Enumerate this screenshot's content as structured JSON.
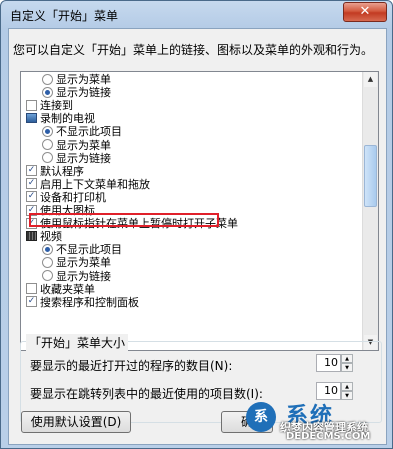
{
  "window": {
    "title": "自定义「开始」菜单",
    "close_glyph": "✕"
  },
  "description": "您可以自定义「开始」菜单上的链接、图标以及菜单的外观和行为。",
  "tree_items": [
    {
      "kind": "radio",
      "indent": 2,
      "checked": false,
      "label": "显示为菜单"
    },
    {
      "kind": "radio",
      "indent": 2,
      "checked": true,
      "label": "显示为链接"
    },
    {
      "kind": "checkbox",
      "indent": 1,
      "checked": false,
      "label": "连接到"
    },
    {
      "kind": "icon",
      "icon": "tv-icon",
      "indent": 1,
      "label": "录制的电视"
    },
    {
      "kind": "radio",
      "indent": 2,
      "checked": true,
      "label": "不显示此项目"
    },
    {
      "kind": "radio",
      "indent": 2,
      "checked": false,
      "label": "显示为菜单"
    },
    {
      "kind": "radio",
      "indent": 2,
      "checked": false,
      "label": "显示为链接"
    },
    {
      "kind": "checkbox",
      "indent": 1,
      "checked": true,
      "label": "默认程序"
    },
    {
      "kind": "checkbox",
      "indent": 1,
      "checked": true,
      "label": "启用上下文菜单和拖放",
      "highlighted": true
    },
    {
      "kind": "checkbox",
      "indent": 1,
      "checked": true,
      "label": "设备和打印机"
    },
    {
      "kind": "checkbox",
      "indent": 1,
      "checked": true,
      "label": "使用大图标"
    },
    {
      "kind": "checkbox",
      "indent": 1,
      "checked": true,
      "label": "使用鼠标指针在菜单上暂停时打开子菜单"
    },
    {
      "kind": "icon",
      "icon": "video-icon",
      "indent": 1,
      "label": "视频"
    },
    {
      "kind": "radio",
      "indent": 2,
      "checked": true,
      "label": "不显示此项目"
    },
    {
      "kind": "radio",
      "indent": 2,
      "checked": false,
      "label": "显示为菜单"
    },
    {
      "kind": "radio",
      "indent": 2,
      "checked": false,
      "label": "显示为链接"
    },
    {
      "kind": "checkbox",
      "indent": 1,
      "checked": false,
      "label": "收藏夹菜单"
    },
    {
      "kind": "checkbox",
      "indent": 1,
      "checked": true,
      "label": "搜索程序和控制面板"
    }
  ],
  "size_group": {
    "title": "「开始」菜单大小",
    "recent_programs_label": "要显示的最近打开过的程序的数目(N):",
    "recent_programs_value": "10",
    "jump_list_label": "要显示在跳转列表中的最近使用的项目数(I):",
    "jump_list_value": "10"
  },
  "buttons": {
    "defaults": "使用默认设置(D)",
    "ok": "确"
  },
  "watermark": {
    "logo": "系",
    "brand": "系统",
    "line1": "织梦内容管理系统",
    "line2": "DEDECMS.COM"
  },
  "colors": {
    "highlight_border": "#e0202a",
    "close_button": "#c23a22"
  }
}
